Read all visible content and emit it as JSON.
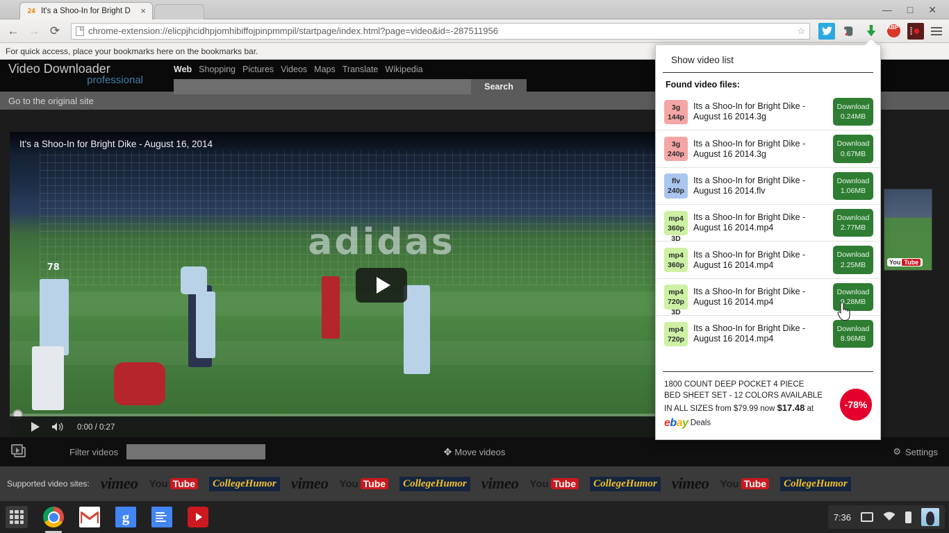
{
  "browser": {
    "tab": {
      "favicon": "24-logo-icon",
      "title": "It's a Shoo-In for Bright D",
      "close": "×"
    },
    "window_controls": {
      "minimize": "—",
      "maximize": "□",
      "close": "✕"
    },
    "nav": {
      "back": "←",
      "forward": "→",
      "reload": "⟳"
    },
    "omnibox": {
      "url": "chrome-extension://elicpjhcidhpjomhibiffojpinpmmpil/startpage/index.html?page=video&id=-287511956",
      "star": "☆"
    },
    "extensions": [
      {
        "name": "twitter-extension-icon",
        "glyph": "✈"
      },
      {
        "name": "evernote-extension-icon",
        "glyph": "◓"
      },
      {
        "name": "video-downloader-extension-icon",
        "glyph": "⬇"
      },
      {
        "name": "adblock-plus-extension-icon",
        "glyph": "ABP"
      },
      {
        "name": "screen-recorder-extension-icon",
        "glyph": "◉"
      }
    ],
    "bookmarks_bar_text": "For quick access, place your bookmarks here on the bookmarks bar."
  },
  "site": {
    "logo_main": "Video Downloader",
    "logo_sub": "professional",
    "nav": [
      "Web",
      "Shopping",
      "Pictures",
      "Videos",
      "Maps",
      "Translate",
      "Wikipedia"
    ],
    "nav_active": "Web",
    "search_value": "",
    "search_placeholder": "",
    "search_button": "Search",
    "original_site_link": "Go to the original site"
  },
  "player": {
    "title": "It's a Shoo-In for Bright Dike - August 16, 2014",
    "play_button": "play-button",
    "current_time": "0:00",
    "duration": "0:27",
    "time_display": "0:00 / 0:27",
    "pitch_ad_text": "adidas",
    "jersey_numbers": [
      "78"
    ]
  },
  "side_thumbnail": {
    "source_badge_you": "You",
    "source_badge_tube": "Tube"
  },
  "bottom_toolbar": {
    "videos_icon": "videos-stack-icon",
    "filter_label": "Filter videos",
    "filter_value": "",
    "filter_placeholder": "",
    "move_videos": "Move videos",
    "move_icon": "✥",
    "settings": "Settings",
    "settings_icon": "⚙"
  },
  "supported_sites": {
    "label": "Supported video sites:",
    "logos": [
      "vimeo",
      "youtube",
      "collegehumor",
      "vimeo",
      "youtube",
      "collegehumor",
      "vimeo",
      "youtube",
      "collegehumor",
      "vimeo",
      "youtube",
      "collegehumor"
    ],
    "youtube_you": "You",
    "youtube_tube": "Tube",
    "vimeo_text": "vimeo",
    "collegehumor_text": "CollegeHumor"
  },
  "popup": {
    "show_video_list": "Show video list",
    "found_heading": "Found video files:",
    "download_label": "Download",
    "videos": [
      {
        "format": "3g",
        "quality": "144p",
        "is3d": false,
        "badge_color": "#f4a6a6",
        "title": "Its a Shoo-In for Bright Dike - August 16 2014.3g",
        "size": "0.24MB"
      },
      {
        "format": "3g",
        "quality": "240p",
        "is3d": false,
        "badge_color": "#f4a6a6",
        "title": "Its a Shoo-In for Bright Dike - August 16 2014.3g",
        "size": "0.67MB"
      },
      {
        "format": "flv",
        "quality": "240p",
        "is3d": false,
        "badge_color": "#aac6ee",
        "title": "Its a Shoo-In for Bright Dike - August 16 2014.flv",
        "size": "1.06MB"
      },
      {
        "format": "mp4",
        "quality": "360p",
        "is3d": true,
        "badge_color": "#cdf0a3",
        "title": "Its a Shoo-In for Bright Dike - August 16 2014.mp4",
        "size": "2.77MB"
      },
      {
        "format": "mp4",
        "quality": "360p",
        "is3d": false,
        "badge_color": "#cdf0a3",
        "title": "Its a Shoo-In for Bright Dike - August 16 2014.mp4",
        "size": "2.25MB"
      },
      {
        "format": "mp4",
        "quality": "720p",
        "is3d": true,
        "badge_color": "#cdf0a3",
        "title": "Its a Shoo-In for Bright Dike - August 16 2014.mp4",
        "size": "9.28MB"
      },
      {
        "format": "mp4",
        "quality": "720p",
        "is3d": false,
        "badge_color": "#cdf0a3",
        "title": "Its a Shoo-In for Bright Dike - August 16 2014.mp4",
        "size": "8.96MB"
      }
    ],
    "three_d_label": "3D",
    "ad": {
      "line1": "1800 COUNT DEEP POCKET 4 PIECE",
      "line2": "BED SHEET SET - 12 COLORS AVAILABLE",
      "line3_pre": "IN ALL SIZES from $79.99 now ",
      "line3_price": "$17.48",
      "line3_post": " at",
      "brand": "ebay",
      "brand_suffix": "Deals",
      "discount": "-78%"
    }
  },
  "taskbar": {
    "launcher": "app-launcher-icon",
    "apps": [
      "chrome",
      "gmail",
      "google-search",
      "google-docs",
      "youtube"
    ],
    "gmail_glyph": "M",
    "google_glyph": "g",
    "tray": {
      "time": "7:36",
      "screen_icon": "display-icon",
      "wifi_icon": "▲",
      "battery_icon": "battery-icon",
      "avatar": "penguin-avatar"
    }
  },
  "colors": {
    "accent_green": "#2e7d32",
    "ad_red": "#e4002b",
    "youtube_red": "#cc181e",
    "link_blue": "#3d7fa5"
  }
}
